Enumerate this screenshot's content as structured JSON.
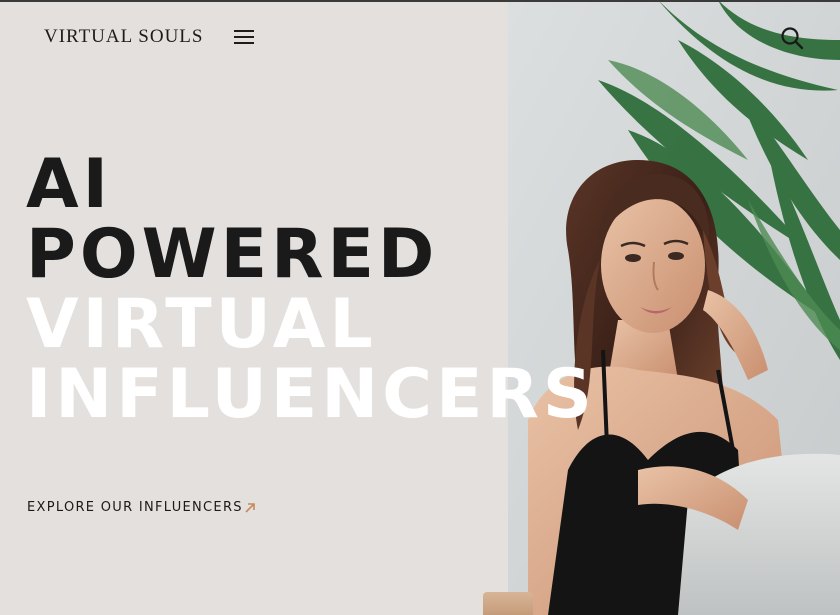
{
  "header": {
    "brand": "VIRTUAL SOULS",
    "menu_icon": "hamburger-menu-icon",
    "search_icon": "search-icon"
  },
  "hero": {
    "line1": "AI",
    "line2": "POWERED",
    "line3": "VIRTUAL",
    "line4": "INFLUENCERS",
    "cta_label": "EXPLORE OUR INFLUENCERS",
    "cta_icon": "arrow-up-right-icon"
  },
  "colors": {
    "background": "#e4e0de",
    "text_dark": "#1a1a1a",
    "text_light": "#ffffff",
    "accent": "#c8895a"
  }
}
